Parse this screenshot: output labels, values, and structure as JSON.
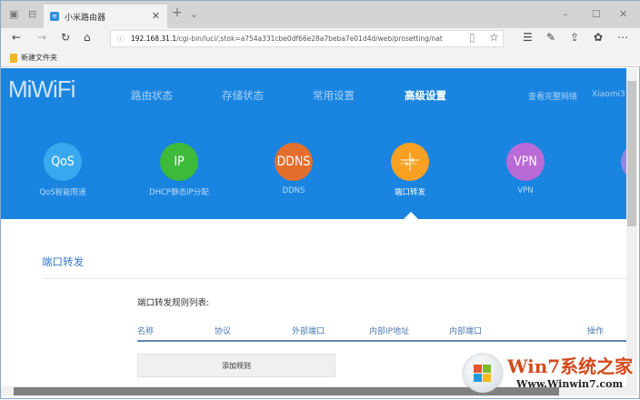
{
  "browser": {
    "tab_title": "小米路由器",
    "url_host": "192.168.31.1",
    "url_path": "/cgi-bin/luci/;stok=a754a331cbe0df66e28a7beba7e01d4d/web/prosetting/nat",
    "favorite_folder": "新建文件夹"
  },
  "header": {
    "logo": "MiWiFi",
    "nav": [
      "路由状态",
      "存储状态",
      "常用设置",
      "高级设置"
    ],
    "active_nav": "高级设置",
    "right_link": "查看完整网络",
    "device": "Xiaomi3"
  },
  "features": [
    {
      "icon_text": "QoS",
      "label": "QoS智能限速",
      "color": "#3aa8ef"
    },
    {
      "icon_text": "IP",
      "label": "DHCP静态IP分配",
      "color": "#3dba3a"
    },
    {
      "icon_text": "DDNS",
      "label": "DDNS",
      "color": "#e36f2c"
    },
    {
      "icon_text": "",
      "label": "端口转发",
      "color": "#f7a022",
      "active": true
    },
    {
      "icon_text": "VPN",
      "label": "VPN",
      "color": "#b86bd6"
    }
  ],
  "content": {
    "title": "端口转发",
    "list_title": "端口转发规则列表:",
    "columns": [
      "名称",
      "协议",
      "外部端口",
      "内部IP地址",
      "内部端口",
      "操作"
    ],
    "add_button": "添加规则"
  },
  "watermark": {
    "title": "Win7系统之家",
    "url": "Www.Winwin7.com"
  }
}
